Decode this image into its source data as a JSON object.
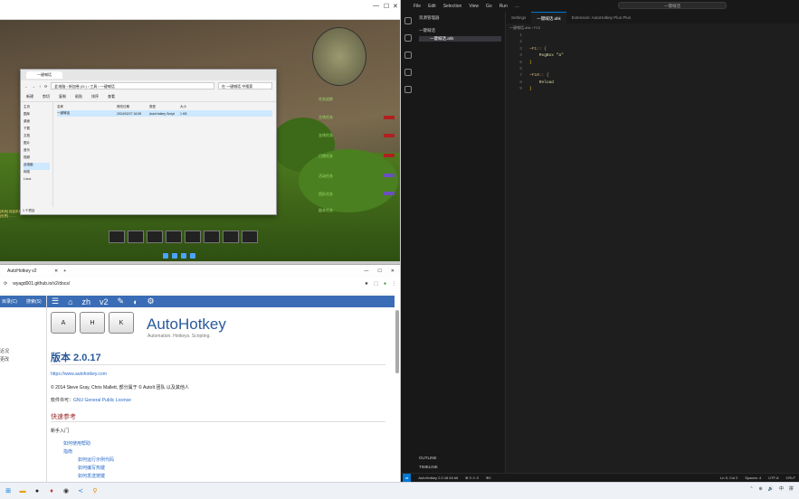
{
  "game_window": {
    "minimap_label": "",
    "quest_lines": [
      "任务追踪",
      "主线任务",
      "支线任务",
      "日常任务",
      "活动任务",
      "团队任务",
      "副本任务"
    ],
    "chat": [
      "[系统] 欢迎来到游戏",
      "[世界] ……"
    ]
  },
  "explorer": {
    "tab": "一键喊话",
    "address": "此电脑 › 新加卷 (D:) › 工具 › 一键喊话",
    "search_placeholder": "在 一键喊话 中搜索",
    "toolbar": [
      "新建",
      "剪切",
      "复制",
      "粘贴",
      "排序",
      "查看"
    ],
    "nav": [
      "主页",
      "图库",
      "桌面",
      "下载",
      "文档",
      "图片",
      "音乐",
      "视频",
      "此电脑",
      "网络",
      "Linux"
    ],
    "columns": [
      "名称",
      "修改日期",
      "类型",
      "大小"
    ],
    "row": {
      "name": "一键喊话",
      "date": "2024/02/27 16:59",
      "type": "AutoHotkey Script",
      "size": "1 KB"
    },
    "status": "1 个项目"
  },
  "browser": {
    "tab_title": "AutoHotkey v2",
    "url": "wyagd001.github.io/v2/docs/",
    "side_tabs": [
      "目录(C)",
      "搜索(S)"
    ],
    "side_links": [
      "近况",
      "更改"
    ],
    "docbar": [
      "☰",
      "⌂",
      "zh",
      "v2",
      "✎",
      "◐",
      "⚙"
    ],
    "keys": [
      "A",
      "H",
      "K"
    ],
    "logo": "AutoHotkey",
    "tagline": "Automation. Hotkeys. Scripting.",
    "version": "版本 2.0.17",
    "site": "https://www.autohotkey.com",
    "copyright": "© 2014 Steve Gray, Chris Mallett, 部分属于 © AutoIt 团队 以及其他人",
    "license_prefix": "软件许可：",
    "license": "GNU General Public License",
    "quickref": "快速参考",
    "beginner": "新手入门",
    "items": [
      "如何使用帮助",
      "指南"
    ],
    "subitems": [
      "如何运行示例代码",
      "如何编写热键",
      "如何发送按键"
    ]
  },
  "vscode": {
    "menu": [
      "File",
      "Edit",
      "Selection",
      "View",
      "Go",
      "Run",
      "…"
    ],
    "search": "一键喊话",
    "explorer_title": "资源管理器",
    "folder": "一键喊话",
    "file": "一键喊话.ahk",
    "tabs": [
      "Settings",
      "一键喊话.ahk",
      "Extension: AutoHotkey Plus Plus"
    ],
    "breadcrumb": "一键喊话.ahk › F10",
    "code": [
      {
        "n": "1",
        "t": ""
      },
      {
        "n": "2",
        "t": ""
      },
      {
        "n": "3",
        "t": "~F1:: {"
      },
      {
        "n": "4",
        "t": "    MsgBox \"a\""
      },
      {
        "n": "5",
        "t": "}"
      },
      {
        "n": "6",
        "t": ""
      },
      {
        "n": "7",
        "t": "~F10:: {"
      },
      {
        "n": "8",
        "t": "    Reload"
      },
      {
        "n": "9",
        "t": "}"
      }
    ],
    "outline": "OUTLINE",
    "timeline": "TIMELINE",
    "status_left": [
      "AutoHotkey 2.0.18 64 bit",
      "⊗ 0 ⚠ 0",
      "⊕0"
    ],
    "status_right": [
      "Ln 9, Col 2",
      "Spaces: 4",
      "UTF-8",
      "CRLF"
    ]
  },
  "taskbar": {
    "tray": [
      "⌃",
      "⊕",
      "🔊",
      "中",
      "拼"
    ]
  }
}
